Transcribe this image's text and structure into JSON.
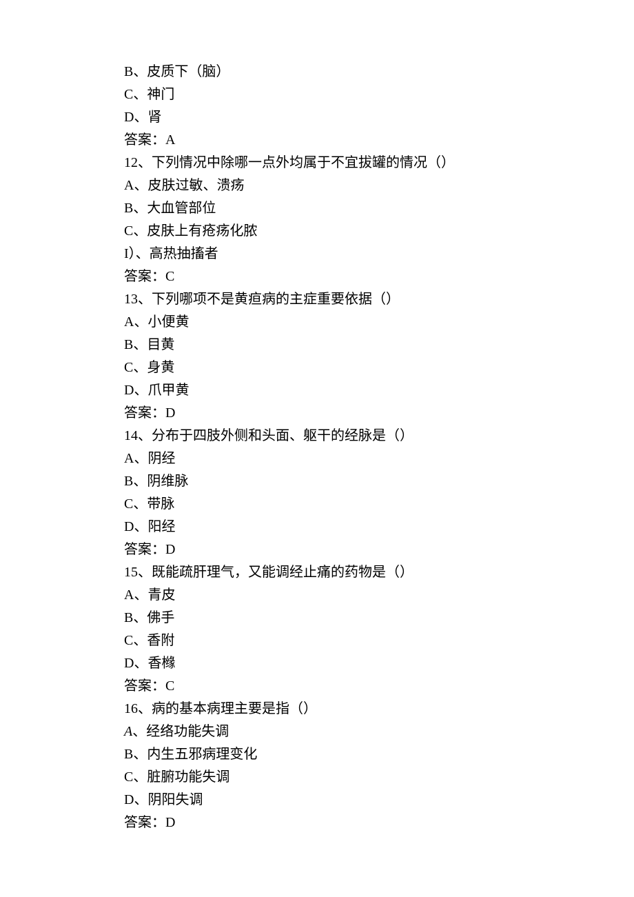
{
  "lines": [
    "B、皮质下（脑）",
    "C、神门",
    "D、肾",
    "答案：A",
    "12、下列情况中除哪一点外均属于不宜拔罐的情况（）",
    "A、皮肤过敏、溃疡",
    "B、大血管部位",
    "C、皮肤上有疮疡化脓",
    "I）、高热抽搐者",
    "答案：C",
    "13、下列哪项不是黄疸病的主症重要依据（）",
    "A、小便黄",
    "B、目黄",
    "C、身黄",
    "D、爪甲黄",
    "答案：D",
    "14、分布于四肢外侧和头面、躯干的经脉是（）",
    "A、阴经",
    "B、阴维脉",
    "C、带脉",
    "D、阳经",
    "答案：D",
    "15、既能疏肝理气，又能调经止痛的药物是（）",
    "A、青皮",
    "B、佛手",
    "C、香附",
    "D、香橼",
    "答案：C",
    "16、病的基本病理主要是指（）",
    "A、经络功能失调",
    "B、内生五邪病理变化",
    "C、脏腑功能失调",
    "D、阴阳失调",
    "答案：D"
  ],
  "italicIndices": [
    29
  ]
}
